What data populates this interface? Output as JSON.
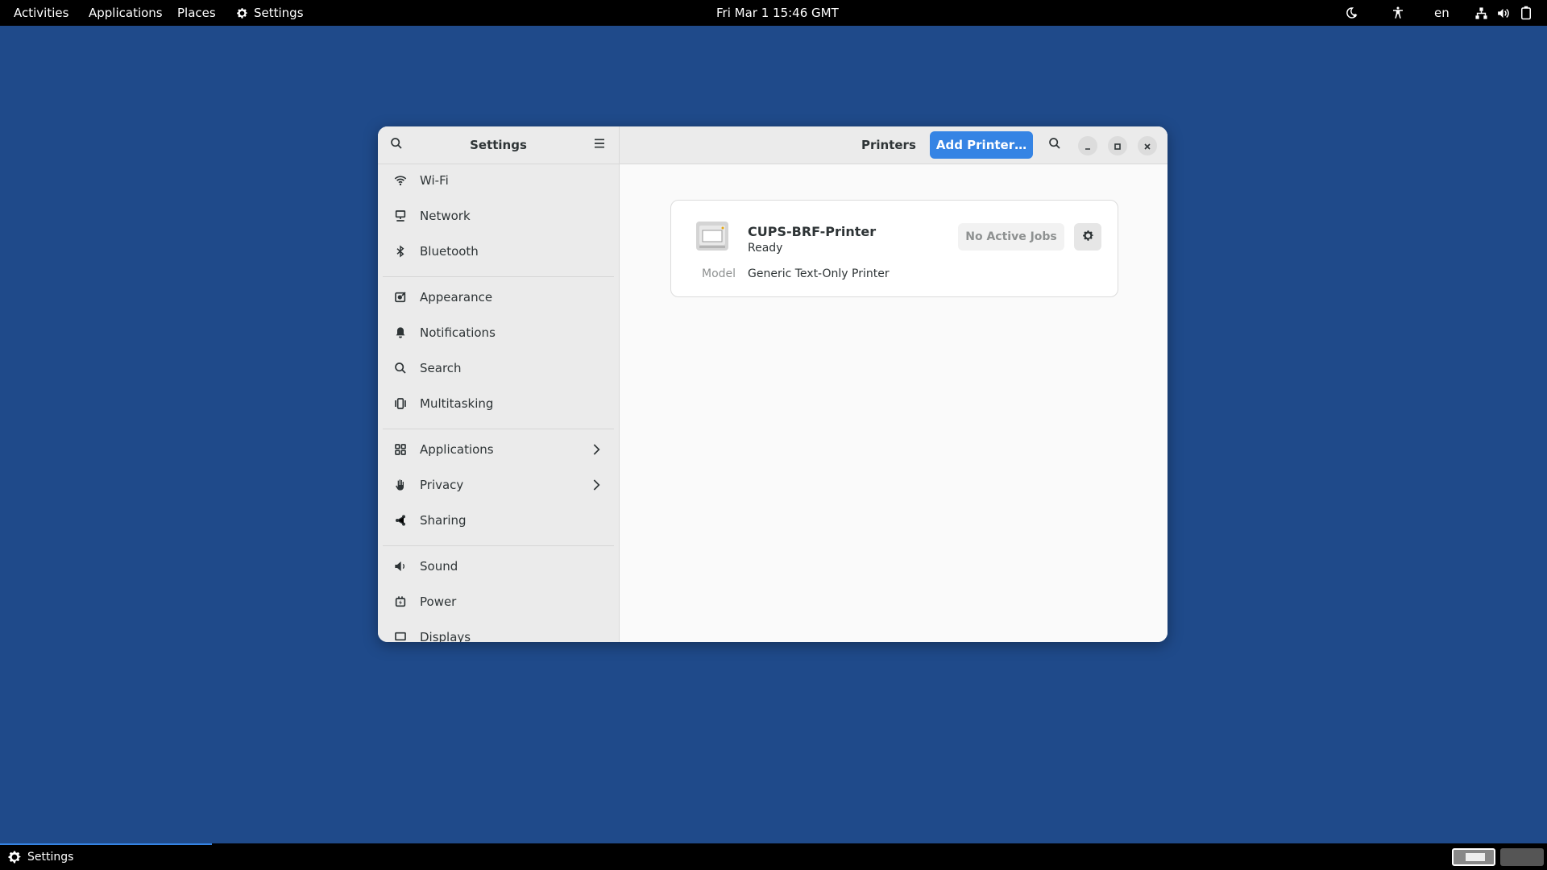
{
  "topbar": {
    "activities": "Activities",
    "applications": "Applications",
    "places": "Places",
    "settings": "Settings",
    "clock": "Fri Mar 1  15:46 GMT",
    "lang": "en"
  },
  "window": {
    "sidebar_title": "Settings",
    "content_title": "Printers",
    "add_printer": "Add Printer…"
  },
  "sidebar": {
    "items": [
      {
        "label": "Wi-Fi",
        "icon": "wifi-icon"
      },
      {
        "label": "Network",
        "icon": "network-icon"
      },
      {
        "label": "Bluetooth",
        "icon": "bluetooth-icon"
      },
      {
        "label": "Appearance",
        "icon": "appearance-icon"
      },
      {
        "label": "Notifications",
        "icon": "bell-icon"
      },
      {
        "label": "Search",
        "icon": "search-icon"
      },
      {
        "label": "Multitasking",
        "icon": "multitasking-icon"
      },
      {
        "label": "Applications",
        "icon": "apps-grid-icon"
      },
      {
        "label": "Privacy",
        "icon": "hand-icon"
      },
      {
        "label": "Sharing",
        "icon": "share-icon"
      },
      {
        "label": "Sound",
        "icon": "speaker-icon"
      },
      {
        "label": "Power",
        "icon": "power-icon"
      },
      {
        "label": "Displays",
        "icon": "display-icon"
      }
    ]
  },
  "printer": {
    "name": "CUPS-BRF-Printer",
    "status": "Ready",
    "jobs": "No Active Jobs",
    "model_label": "Model",
    "model_value": "Generic Text-Only Printer"
  },
  "taskbar": {
    "task_label": "Settings"
  },
  "colors": {
    "desktop": "#1f4a8a",
    "accent": "#3584e4"
  }
}
